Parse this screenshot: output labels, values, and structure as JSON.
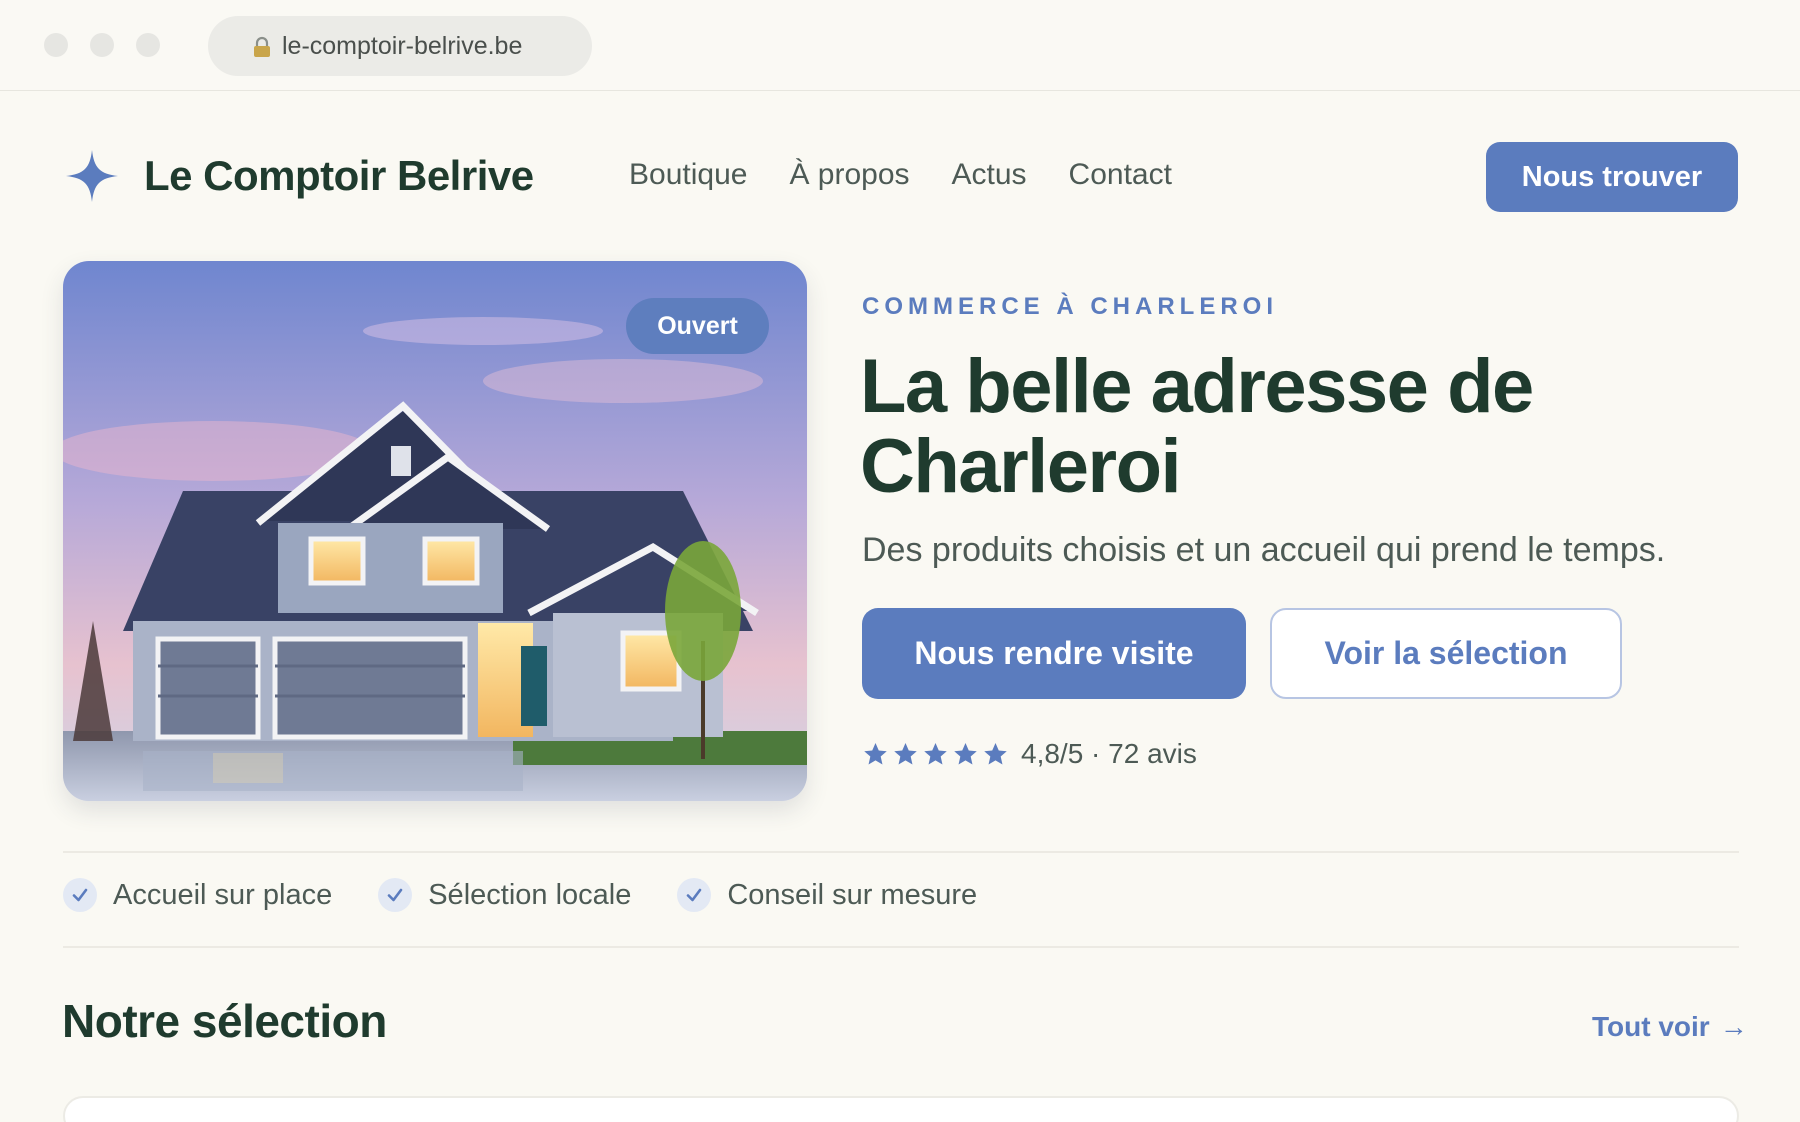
{
  "browser": {
    "url": "le-comptoir-belrive.be"
  },
  "brand": {
    "name": "Le Comptoir Belrive",
    "accent": "#5b7cbe",
    "text_color": "#1f3b2e"
  },
  "nav": {
    "items": [
      {
        "label": "Boutique"
      },
      {
        "label": "À propos"
      },
      {
        "label": "Actus"
      },
      {
        "label": "Contact"
      }
    ],
    "cta": "Nous trouver"
  },
  "hero": {
    "badge": "Ouvert",
    "eyebrow": "COMMERCE À CHARLEROI",
    "title": "La belle adresse de Charleroi",
    "subtitle": "Des produits choisis et un accueil qui prend le temps.",
    "primary_cta": "Nous rendre visite",
    "secondary_cta": "Voir la sélection",
    "rating": {
      "stars": 5,
      "text": "4,8/5 · 72 avis"
    }
  },
  "features": [
    {
      "label": "Accueil sur place"
    },
    {
      "label": "Sélection locale"
    },
    {
      "label": "Conseil sur mesure"
    }
  ],
  "selection": {
    "title": "Notre sélection",
    "see_all": "Tout voir",
    "arrow": "→"
  }
}
